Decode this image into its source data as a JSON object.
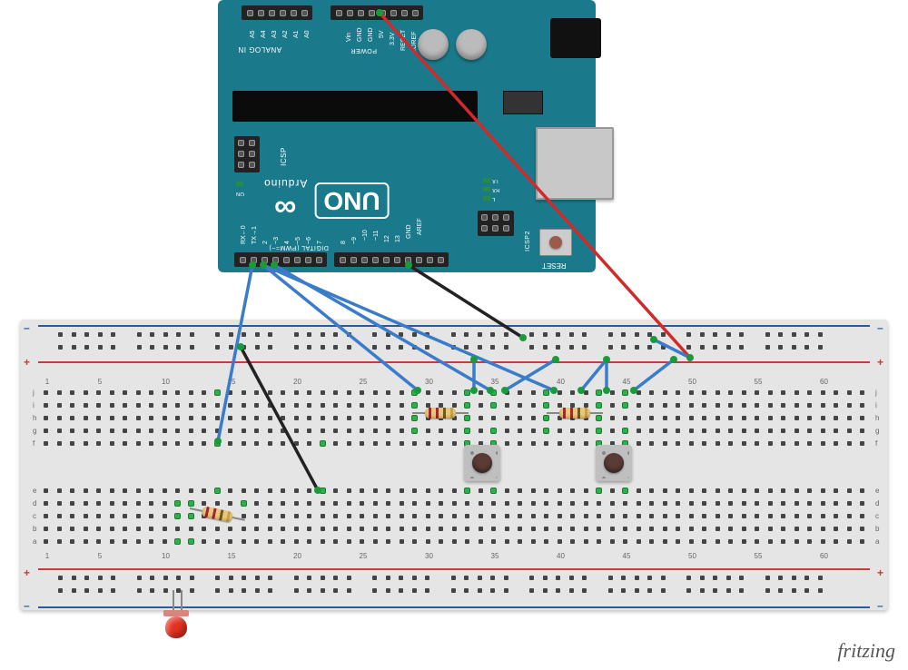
{
  "watermark": "fritzing",
  "arduino": {
    "board_name": "UNO",
    "brand": "Arduino",
    "reset_label": "RESET",
    "icsp_label": "ICSP",
    "icsp2_label": "ICSP2",
    "analog_in_label": "ANALOG IN",
    "power_label": "POWER",
    "digital_label": "DIGITAL (PWM=~)",
    "leds": {
      "on": "ON",
      "tx": "TX",
      "rx": "RX",
      "l": "L"
    },
    "analog_pins": [
      "A0",
      "A1",
      "A2",
      "A3",
      "A4",
      "A5"
    ],
    "power_pins": [
      "IOREF",
      "RESET",
      "3.3V",
      "5V",
      "GND",
      "GND",
      "Vin"
    ],
    "digital_pins_left": [
      "AREF",
      "GND",
      "13",
      "12",
      "~11",
      "~10",
      "~9",
      "8"
    ],
    "digital_pins_right": [
      "7",
      "~6",
      "~5",
      "4",
      "~3",
      "2",
      "TX→1",
      "RX←0"
    ]
  },
  "breadboard": {
    "rows_top": [
      "j",
      "i",
      "h",
      "g",
      "f"
    ],
    "rows_bottom": [
      "e",
      "d",
      "c",
      "b",
      "a"
    ],
    "col_start": 1,
    "col_end": 63,
    "rail_symbols": {
      "plus": "+",
      "minus": "–"
    }
  },
  "components": {
    "led": {
      "color": "red",
      "position_col": 11
    },
    "resistors": [
      {
        "cols": "12-16",
        "row": "d"
      },
      {
        "cols": "29-33",
        "row": "h"
      },
      {
        "cols": "39-43",
        "row": "h"
      }
    ],
    "buttons": [
      {
        "cols": "33-35"
      },
      {
        "cols": "43-45"
      }
    ]
  },
  "wires": [
    {
      "color": "red",
      "from": "Arduino 5V",
      "to": "breadboard + rail"
    },
    {
      "color": "black",
      "from": "Arduino GND (digital side)",
      "to": "breadboard – rail"
    },
    {
      "color": "black",
      "from": "bb col15 row f",
      "to": "bb col22 row e"
    },
    {
      "color": "blue",
      "from": "Arduino D1",
      "to": "bb col14 row f"
    },
    {
      "color": "blue",
      "from": "Arduino D2",
      "to": "bb col35 row i"
    },
    {
      "color": "blue",
      "from": "Arduino D3",
      "to": "bb col29 row i"
    },
    {
      "color": "blue",
      "from": "Arduino D2",
      "to": "bb col39 row i"
    },
    {
      "color": "blue",
      "from": "bb col33 bottom rail",
      "to": "bb col33 row j"
    },
    {
      "color": "blue",
      "from": "bb col41 top rail",
      "to": "bb col35 row j"
    },
    {
      "color": "blue",
      "from": "bb col43 row j",
      "to": "+ rail"
    },
    {
      "color": "blue",
      "from": "bb col47 top rail",
      "to": "bb col45 row j"
    },
    {
      "color": "blue",
      "from": "bb col49 + rail",
      "to": "bb col51 – rail"
    }
  ]
}
